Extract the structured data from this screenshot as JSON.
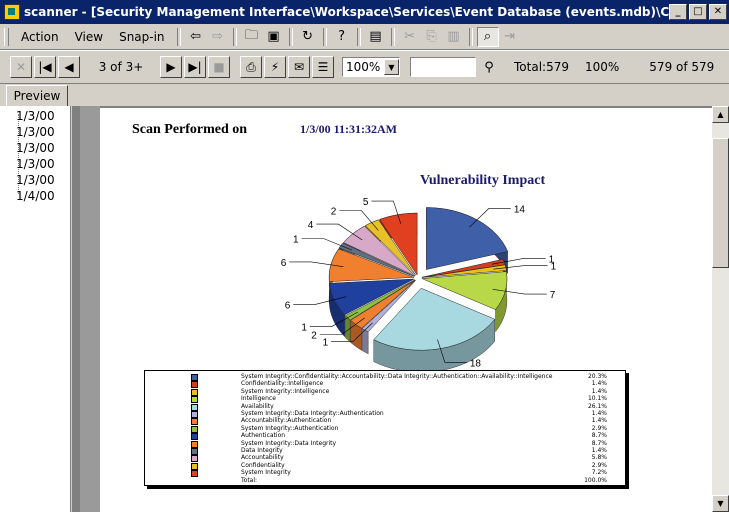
{
  "window": {
    "title": "scanner - [Security Management Interface\\Workspace\\Services\\Event Database (events.mdb)\\CyberCop Scanner]"
  },
  "menu": {
    "items": [
      "Action",
      "View",
      "Snap-in"
    ]
  },
  "toolbar": {
    "page_label": "3 of 3+",
    "zoom_value": "100%",
    "find_value": "",
    "total_label": "Total:579",
    "percent_label": "100%",
    "count_label": "579 of 579"
  },
  "tabs": {
    "preview_label": "Preview"
  },
  "tree": {
    "items": [
      "1/3/00",
      "1/3/00",
      "1/3/00",
      "1/3/00",
      "1/3/00",
      "1/4/00"
    ]
  },
  "report": {
    "scan_label": "Scan Performed on",
    "scan_datetime": "1/3/00  11:31:32AM"
  },
  "chart_data": {
    "type": "pie",
    "title": "Vulnerability Impact",
    "slice_labels": [
      "14",
      "1",
      "1",
      "7",
      "18",
      "1",
      "2",
      "1",
      "6",
      "6",
      "1",
      "4",
      "2",
      "5"
    ],
    "values": [
      14,
      1,
      1,
      7,
      18,
      1,
      2,
      1,
      6,
      6,
      1,
      4,
      2,
      5
    ],
    "colors": [
      "#3f5fa8",
      "#d04020",
      "#e8c020",
      "#b8d848",
      "#a8d8e0",
      "#b0b0d8",
      "#f08030",
      "#90c040",
      "#2040a0",
      "#f08030",
      "#607080",
      "#d8a8c8",
      "#e8c028",
      "#e04020"
    ],
    "legend": [
      {
        "label": "System Integrity::Confidentiality::Accountability::Data Integrity::Authentication::Availability::Intelligence",
        "value": "20.3%",
        "color": "#3f5fa8"
      },
      {
        "label": "Confidentiality::Intelligence",
        "value": "1.4%",
        "color": "#d04020"
      },
      {
        "label": "System Integrity::Intelligence",
        "value": "1.4%",
        "color": "#e8c020"
      },
      {
        "label": "Intelligence",
        "value": "10.1%",
        "color": "#b8d848"
      },
      {
        "label": "Availability",
        "value": "26.1%",
        "color": "#a8d8e0"
      },
      {
        "label": "System Integrity::Data Integrity::Authentication",
        "value": "1.4%",
        "color": "#b0b0d8"
      },
      {
        "label": "Accountability::Authentication",
        "value": "1.4%",
        "color": "#f08030"
      },
      {
        "label": "System Integrity::Authentication",
        "value": "2.9%",
        "color": "#90c040"
      },
      {
        "label": "Authentication",
        "value": "8.7%",
        "color": "#2040a0"
      },
      {
        "label": "System Integrity::Data Integrity",
        "value": "8.7%",
        "color": "#f08030"
      },
      {
        "label": "Data Integrity",
        "value": "1.4%",
        "color": "#607080"
      },
      {
        "label": "Accountability",
        "value": "5.8%",
        "color": "#d8a8c8"
      },
      {
        "label": "Confidentiality",
        "value": "2.9%",
        "color": "#e8c028"
      },
      {
        "label": "System Integrity",
        "value": "7.2%",
        "color": "#e04020"
      },
      {
        "label": "Total:",
        "value": "100.0%",
        "color": ""
      }
    ]
  }
}
